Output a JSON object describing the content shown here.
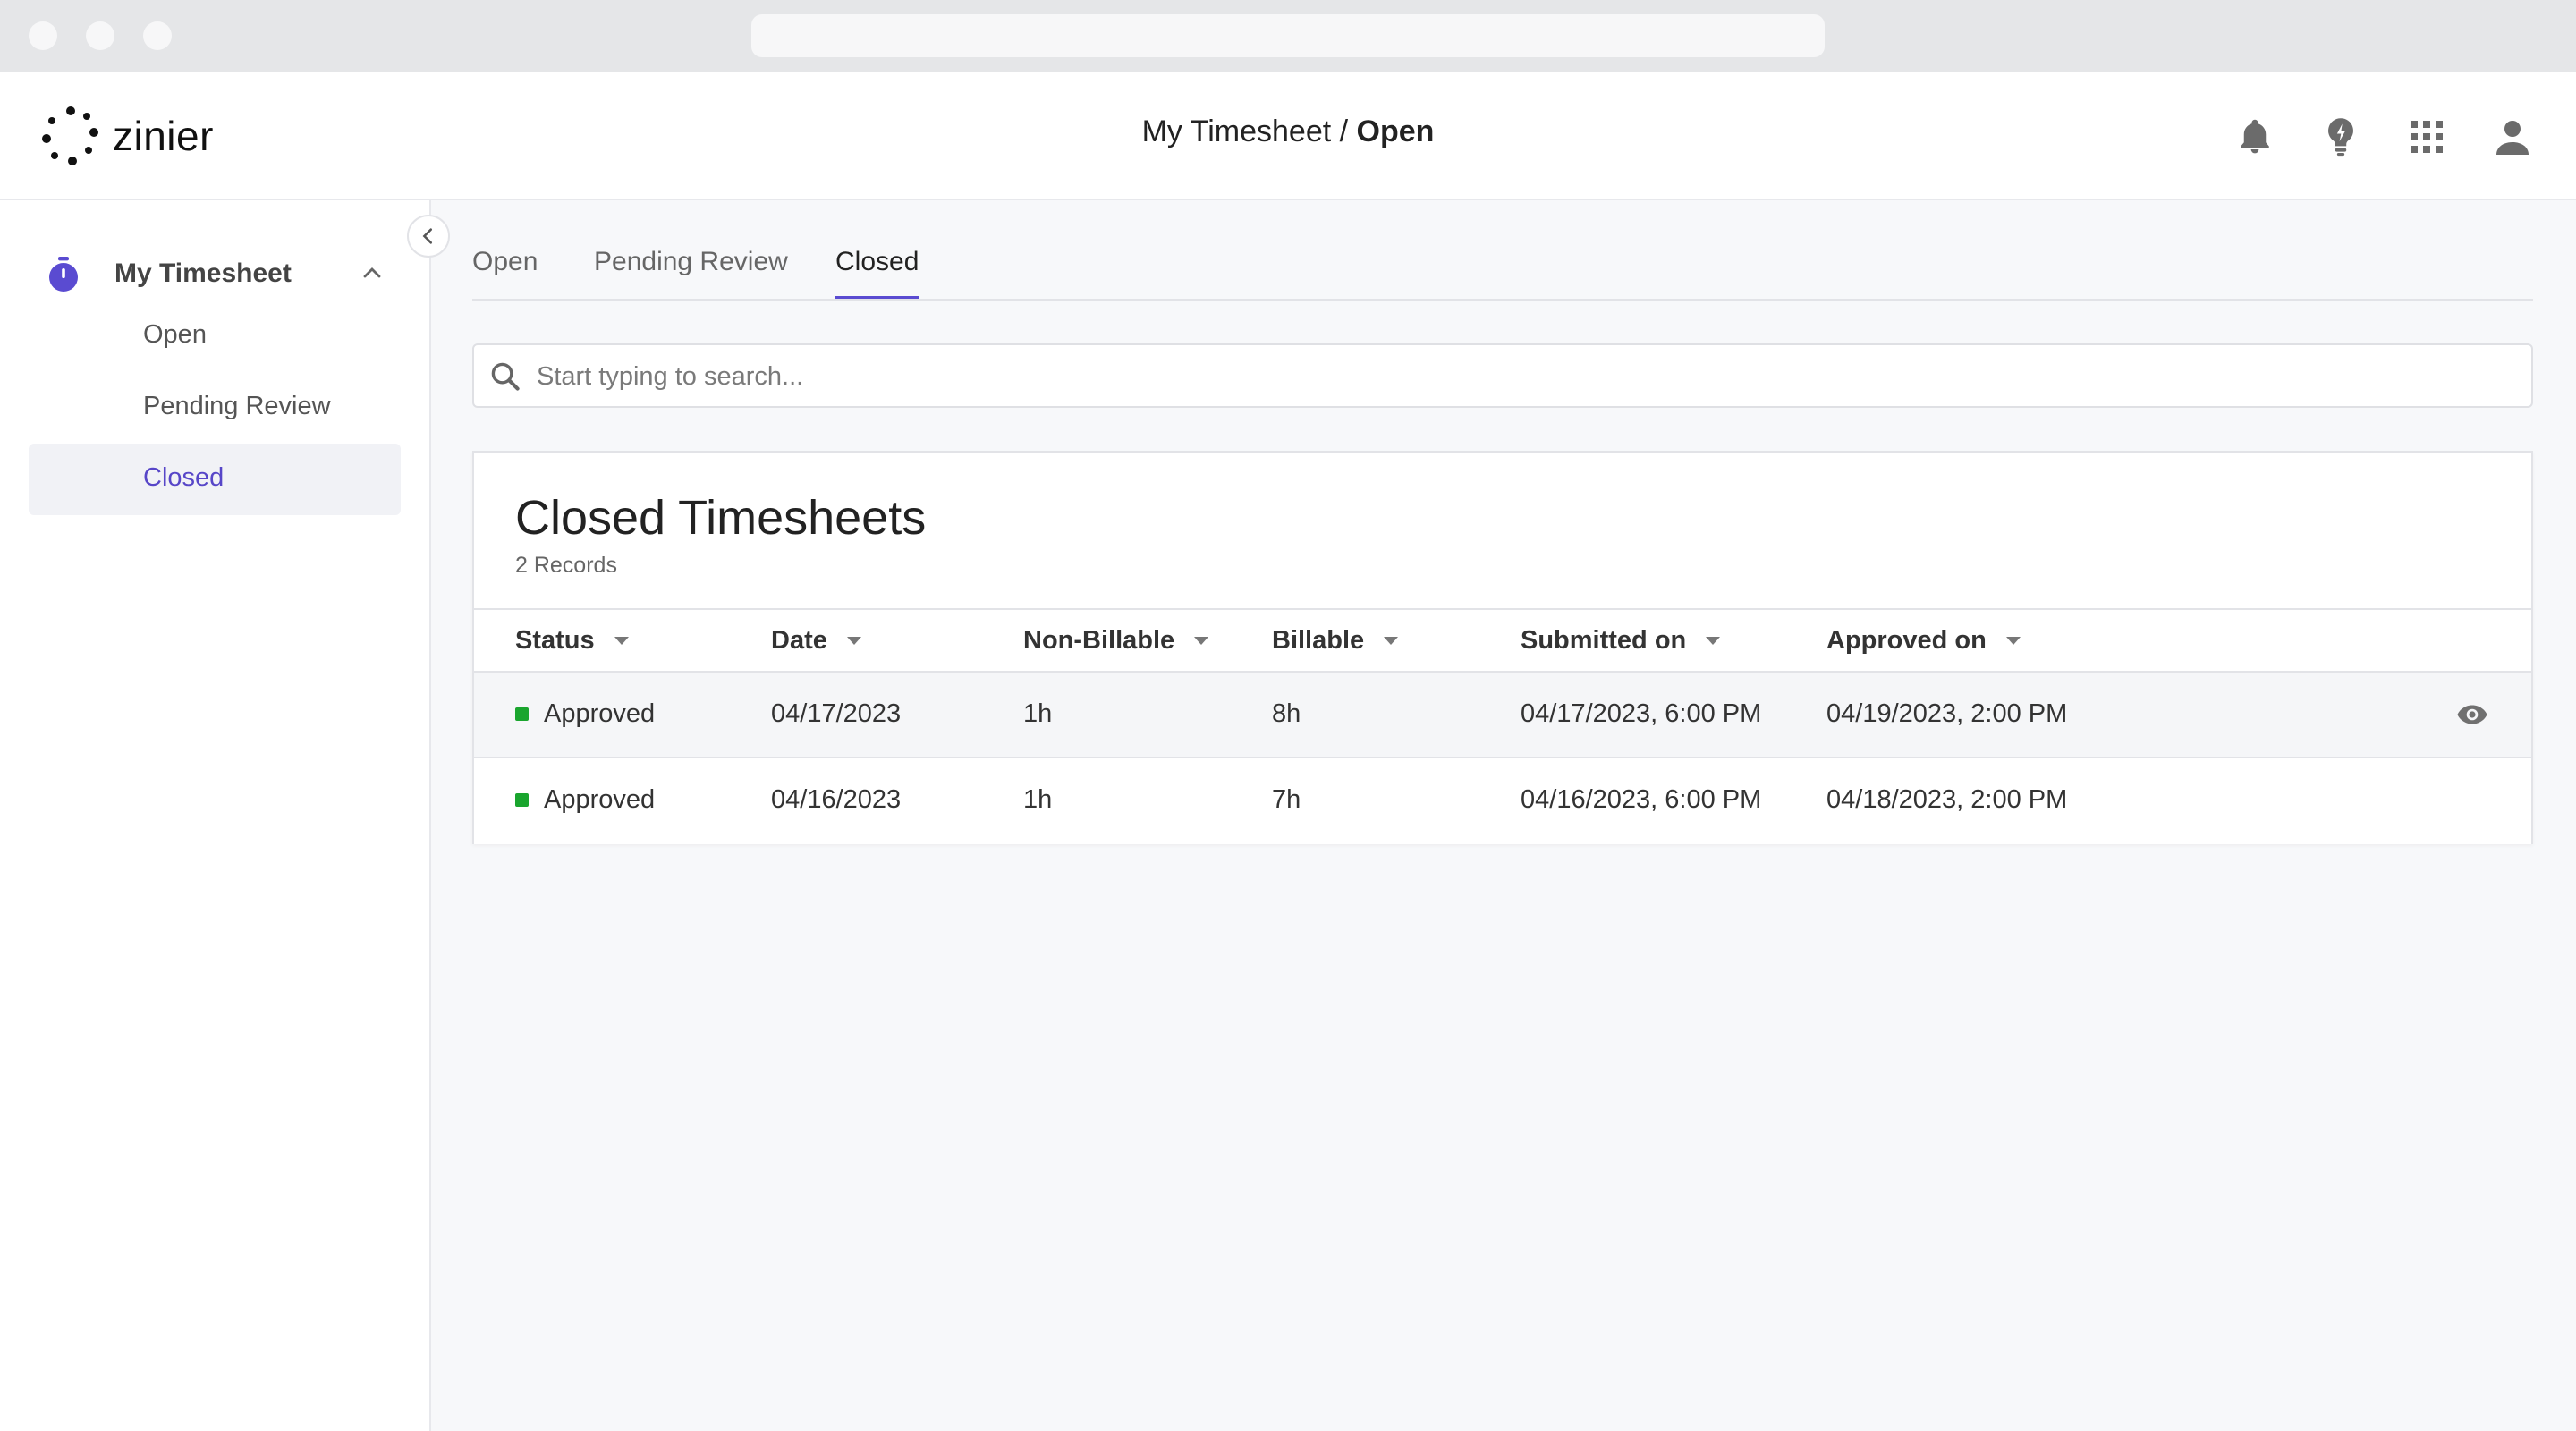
{
  "header": {
    "logo_text": "zinier",
    "title_prefix": "My Timesheet / ",
    "title_current": "Open",
    "icons": [
      "bell-icon",
      "lightbulb-icon",
      "apps-grid-icon",
      "user-icon"
    ]
  },
  "sidebar": {
    "group_label": "My Timesheet",
    "group_icon": "stopwatch-icon",
    "items": [
      {
        "label": "Open"
      },
      {
        "label": "Pending Review"
      },
      {
        "label": "Closed"
      }
    ]
  },
  "tabs": [
    {
      "label": "Open"
    },
    {
      "label": "Pending Review"
    },
    {
      "label": "Closed"
    }
  ],
  "search": {
    "placeholder": "Start typing to search..."
  },
  "table": {
    "title": "Closed Timesheets",
    "subtitle": "2 Records",
    "columns": [
      "Status",
      "Date",
      "Non-Billable",
      "Billable",
      "Submitted on",
      "Approved on"
    ],
    "rows": [
      {
        "status": "Approved",
        "date": "04/17/2023",
        "non_billable": "1h",
        "billable": "8h",
        "submitted_on": "04/17/2023, 6:00 PM",
        "approved_on": "04/19/2023, 2:00 PM"
      },
      {
        "status": "Approved",
        "date": "04/16/2023",
        "non_billable": "1h",
        "billable": "7h",
        "submitted_on": "04/16/2023, 6:00 PM",
        "approved_on": "04/18/2023, 2:00 PM"
      }
    ]
  },
  "colors": {
    "accent": "#5a4bd1",
    "approved": "#1aa52e",
    "icon_gray": "#6b6b6b"
  }
}
